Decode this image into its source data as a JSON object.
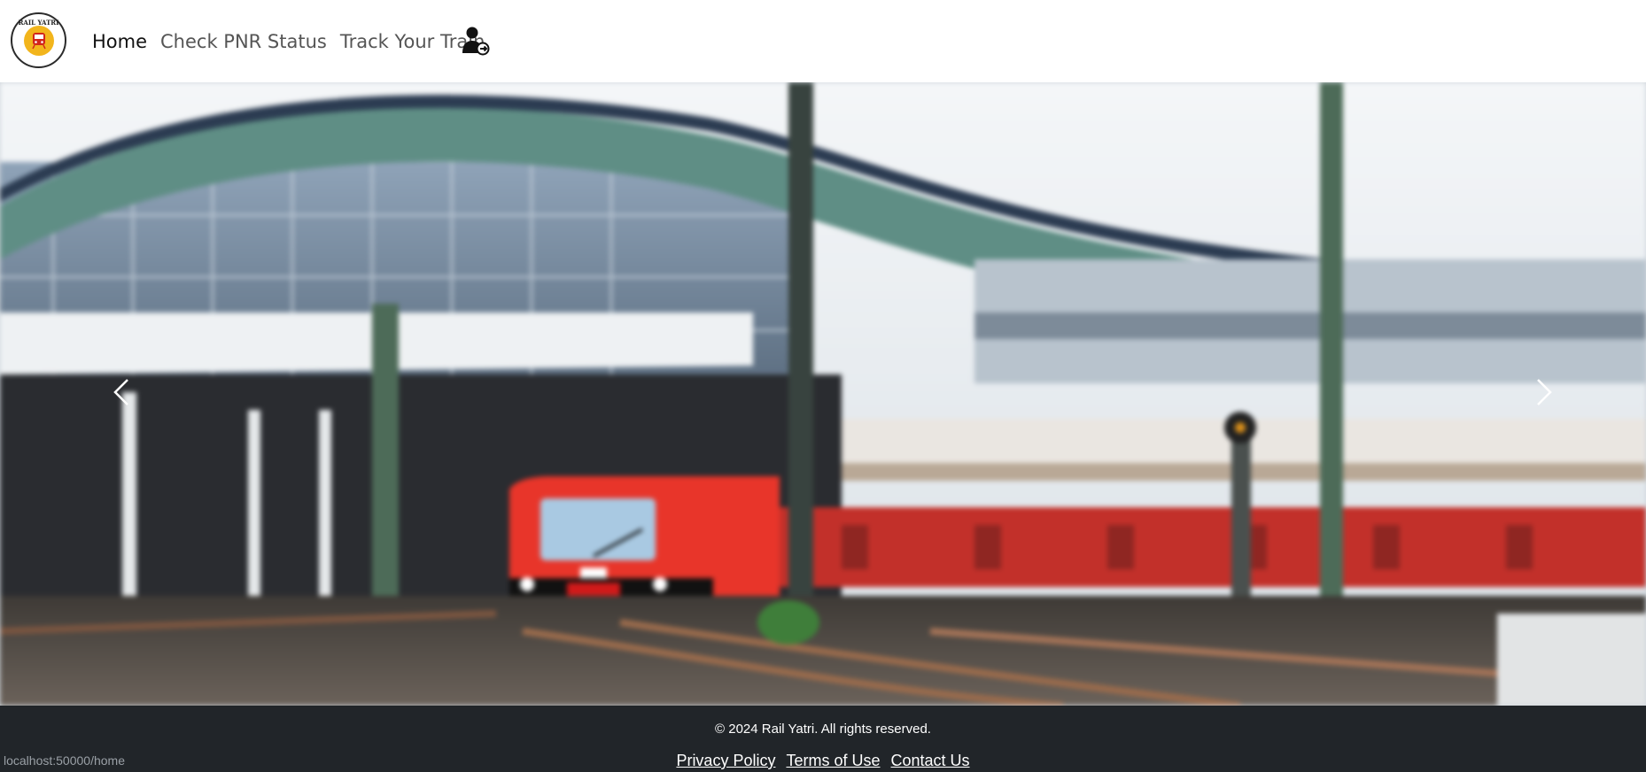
{
  "brand": {
    "logo_text": "RAIL YATRI"
  },
  "nav": {
    "items": [
      {
        "label": "Home",
        "active": true
      },
      {
        "label": "Check PNR Status",
        "active": false
      },
      {
        "label": "Track Your Train",
        "active": false
      }
    ],
    "user_icon": "user-logout-icon"
  },
  "carousel": {
    "image": "train-station-red-train",
    "prev_icon": "chevron-left-icon",
    "next_icon": "chevron-right-icon"
  },
  "footer": {
    "copyright": "© 2024 Rail Yatri. All rights reserved.",
    "links": [
      "Privacy Policy",
      "Terms of Use",
      "Contact Us"
    ]
  },
  "status_bar": {
    "url": "localhost:50000/home"
  },
  "colors": {
    "footer_bg": "#212529",
    "logo_accent": "#f2b51c",
    "train_red": "#e8352a"
  }
}
